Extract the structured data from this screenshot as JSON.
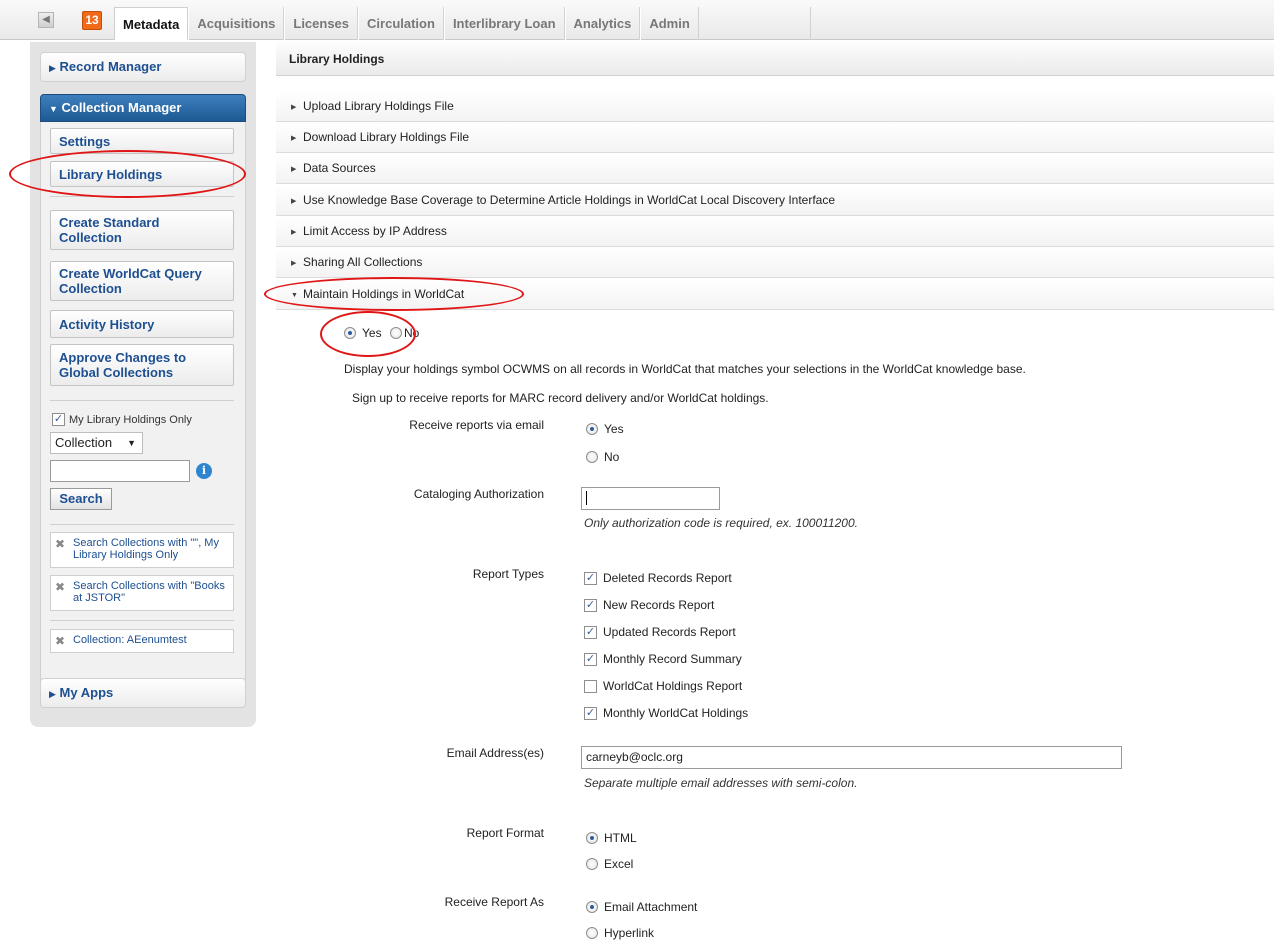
{
  "topnav": {
    "badge": "13",
    "tabs": [
      "Metadata",
      "Acquisitions",
      "Licenses",
      "Circulation",
      "Interlibrary Loan",
      "Analytics",
      "Admin"
    ],
    "active_tab": "Metadata",
    "collapse_icon": "collapse-left-icon"
  },
  "sidebar": {
    "record_manager": "Record Manager",
    "collection_manager": "Collection Manager",
    "settings": "Settings",
    "library_holdings": "Library Holdings",
    "create_standard": "Create Standard Collection",
    "create_worldcat_query": "Create WorldCat Query Collection",
    "activity_history": "Activity History",
    "approve_changes": "Approve Changes to Global Collections",
    "my_holdings_only": "My Library Holdings Only",
    "scope_select": "Collection",
    "search_value": "",
    "search_button": "Search",
    "crumbs": [
      "Search Collections with \"\", My Library Holdings Only",
      "Search Collections with \"Books at JSTOR\"",
      "Collection: AEenumtest"
    ],
    "my_apps": "My Apps"
  },
  "main": {
    "title": "Library Holdings",
    "sections": [
      "Upload Library Holdings File",
      "Download Library Holdings File",
      "Data Sources",
      "Use Knowledge Base Coverage to Determine Article Holdings in WorldCat Local Discovery Interface",
      "Limit Access by IP Address",
      "Sharing All Collections",
      "Maintain Holdings in WorldCat"
    ],
    "maintain": {
      "yes": "Yes",
      "no": "No",
      "selected": "Yes",
      "description": "Display your holdings symbol OCWMS on all records in WorldCat that matches your selections in the WorldCat knowledge base.",
      "signup": "Sign up to receive reports for MARC record delivery and/or WorldCat holdings.",
      "receive_email_label": "Receive reports via email",
      "receive_email_options": [
        "Yes",
        "No"
      ],
      "receive_email_selected": "Yes",
      "cataloging_label": "Cataloging Authorization",
      "cataloging_value": "",
      "cataloging_note": "Only authorization code is required, ex. 100011200.",
      "report_types_label": "Report Types",
      "report_types": [
        {
          "label": "Deleted Records Report",
          "checked": true
        },
        {
          "label": "New Records Report",
          "checked": true
        },
        {
          "label": "Updated Records Report",
          "checked": true
        },
        {
          "label": "Monthly Record Summary",
          "checked": true
        },
        {
          "label": "WorldCat Holdings Report",
          "checked": false
        },
        {
          "label": "Monthly WorldCat Holdings",
          "checked": true
        }
      ],
      "email_label": "Email Address(es)",
      "email_value": "carneyb@oclc.org",
      "email_note": "Separate multiple email addresses with semi-colon.",
      "format_label": "Report Format",
      "format_options": [
        "HTML",
        "Excel"
      ],
      "format_selected": "HTML",
      "receive_as_label": "Receive Report As",
      "receive_as_options": [
        "Email Attachment",
        "Hyperlink"
      ],
      "receive_as_selected": "Email Attachment"
    }
  },
  "colors": {
    "accent_blue": "#1d4f91",
    "collection_header": "#2b6aa6",
    "badge_orange": "#f06a1a",
    "annotation_red": "#e01515"
  }
}
